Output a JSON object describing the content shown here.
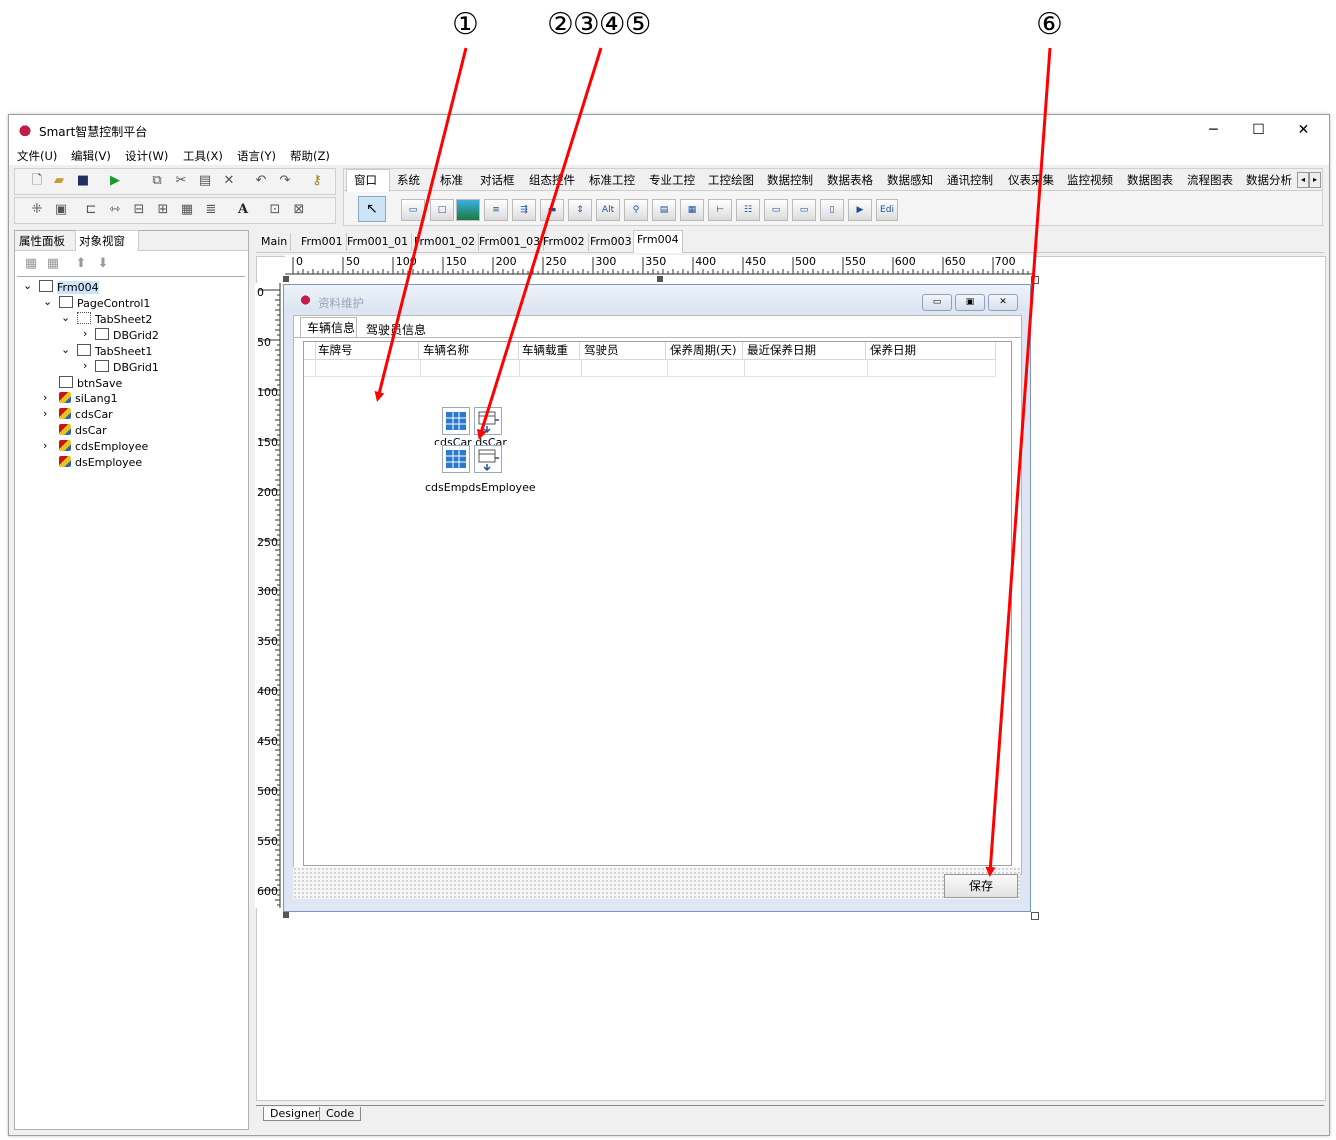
{
  "annotations": {
    "a1": "①",
    "a2": "②③④⑤",
    "a3": "⑥"
  },
  "window": {
    "title": "Smart智慧控制平台",
    "minimize": "─",
    "maximize": "☐",
    "close": "✕"
  },
  "menu": [
    "文件(U)",
    "编辑(V)",
    "设计(W)",
    "工具(X)",
    "语言(Y)",
    "帮助(Z)"
  ],
  "palette_tabs": [
    "窗口",
    "系统",
    "标准",
    "对话框",
    "组态控件",
    "标准工控",
    "专业工控",
    "工控绘图",
    "数据控制",
    "数据表格",
    "数据感知",
    "通讯控制",
    "仪表采集",
    "监控视频",
    "数据图表",
    "流程图表",
    "数据分析"
  ],
  "palette_extra": "Edi",
  "left_tabs": [
    "属性面板",
    "对象视窗"
  ],
  "tree": [
    {
      "label": "Frm004",
      "level": 0
    },
    {
      "label": "PageControl1",
      "level": 1
    },
    {
      "label": "TabSheet2",
      "level": 2
    },
    {
      "label": "DBGrid2",
      "level": 3
    },
    {
      "label": "TabSheet1",
      "level": 2
    },
    {
      "label": "DBGrid1",
      "level": 3
    },
    {
      "label": "btnSave",
      "level": 1
    },
    {
      "label": "siLang1",
      "level": 1
    },
    {
      "label": "cdsCar",
      "level": 1
    },
    {
      "label": "dsCar",
      "level": 1
    },
    {
      "label": "cdsEmployee",
      "level": 1
    },
    {
      "label": "dsEmployee",
      "level": 1
    }
  ],
  "doc_tabs": [
    "Main",
    "Frm001",
    "Frm001_01",
    "Frm001_02",
    "Frm001_03",
    "Frm002",
    "Frm003",
    "Frm004"
  ],
  "ruler_h": [
    "0",
    "50",
    "100",
    "150",
    "200",
    "250",
    "300",
    "350",
    "400",
    "450",
    "500",
    "550",
    "600",
    "650",
    "700"
  ],
  "ruler_v": [
    "0",
    "50",
    "100",
    "150",
    "200",
    "250",
    "300",
    "350",
    "400",
    "450",
    "500",
    "550",
    "600"
  ],
  "form": {
    "title": "资料维护",
    "tabs": [
      "车辆信息",
      "驾驶员信息"
    ],
    "columns": [
      "车牌号",
      "车辆名称",
      "车辆载重",
      "驾驶员",
      "保养周期(天)",
      "最近保养日期",
      "保养日期"
    ],
    "comp_label_1": "cdsCar dsCar",
    "comp_label_2": "cdsEmpdsEmployee",
    "save_button": "保存"
  },
  "bottom_tabs": [
    "Designer",
    "Code"
  ],
  "colors": {
    "arrow": "#ff0000",
    "form_bg": "#dde6f2"
  }
}
